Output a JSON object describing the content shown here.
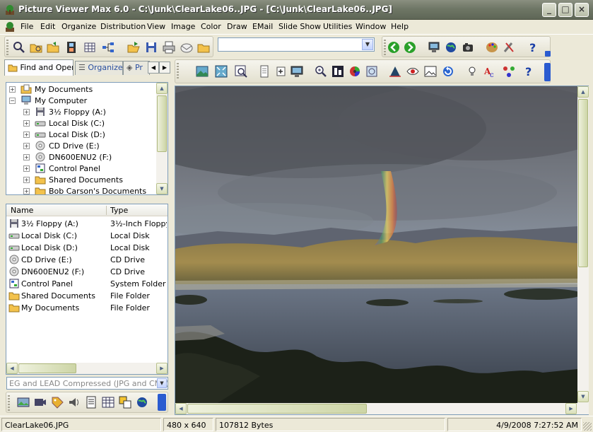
{
  "window": {
    "title": "Picture Viewer Max 6.0 - C:\\Junk\\ClearLake06..JPG - [C:\\Junk\\ClearLake06..JPG]",
    "controls": [
      "_",
      "□",
      "×"
    ]
  },
  "menu": [
    "File",
    "Edit",
    "Organize",
    "Distribution",
    "View",
    "Image",
    "Color",
    "Draw",
    "EMail",
    "Slide Show",
    "Utilities",
    "Window",
    "Help"
  ],
  "toolbar": {
    "path_combo_value": ""
  },
  "left_pane": {
    "tabs": [
      "Find and Open",
      "Organize",
      "Pr"
    ],
    "tree": [
      {
        "label": "My Documents",
        "expander": "+",
        "icon": "folder-documents-icon"
      },
      {
        "label": "My Computer",
        "expander": "−",
        "icon": "computer-icon"
      },
      {
        "label": "3½ Floppy (A:)",
        "expander": "+",
        "icon": "floppy-icon"
      },
      {
        "label": "Local Disk (C:)",
        "expander": "+",
        "icon": "disk-icon"
      },
      {
        "label": "Local Disk (D:)",
        "expander": "+",
        "icon": "disk-icon"
      },
      {
        "label": "CD Drive (E:)",
        "expander": "+",
        "icon": "cd-icon"
      },
      {
        "label": "DN600ENU2 (F:)",
        "expander": "+",
        "icon": "cd-icon"
      },
      {
        "label": "Control Panel",
        "expander": "+",
        "icon": "control-panel-icon"
      },
      {
        "label": "Shared Documents",
        "expander": "+",
        "icon": "folder-icon"
      },
      {
        "label": "Bob Carson's Documents",
        "expander": "+",
        "icon": "folder-icon"
      }
    ],
    "list_columns": [
      "Name",
      "Type"
    ],
    "list_rows": [
      {
        "name": "3½ Floppy (A:)",
        "type": "3½-Inch Floppy D",
        "icon": "floppy-icon"
      },
      {
        "name": "Local Disk (C:)",
        "type": "Local Disk",
        "icon": "disk-icon"
      },
      {
        "name": "Local Disk (D:)",
        "type": "Local Disk",
        "icon": "disk-icon"
      },
      {
        "name": "CD Drive (E:)",
        "type": "CD Drive",
        "icon": "cd-icon"
      },
      {
        "name": "DN600ENU2 (F:)",
        "type": "CD Drive",
        "icon": "cd-icon"
      },
      {
        "name": "Control Panel",
        "type": "System Folder",
        "icon": "control-panel-icon"
      },
      {
        "name": "Shared Documents",
        "type": "File Folder",
        "icon": "folder-icon"
      },
      {
        "name": "My Documents",
        "type": "File Folder",
        "icon": "folder-icon"
      }
    ],
    "filter": "EG and LEAD Compressed (JPG and CMP)"
  },
  "status": {
    "filename": "ClearLake06.JPG",
    "dimensions": "480 x 640",
    "size": "107812 Bytes",
    "datetime": "4/9/2008 7:27:52 AM"
  },
  "colors": {
    "titlebar": "#6f7766",
    "xp_face": "#ece9d8",
    "border_blue": "#7f9db9"
  }
}
